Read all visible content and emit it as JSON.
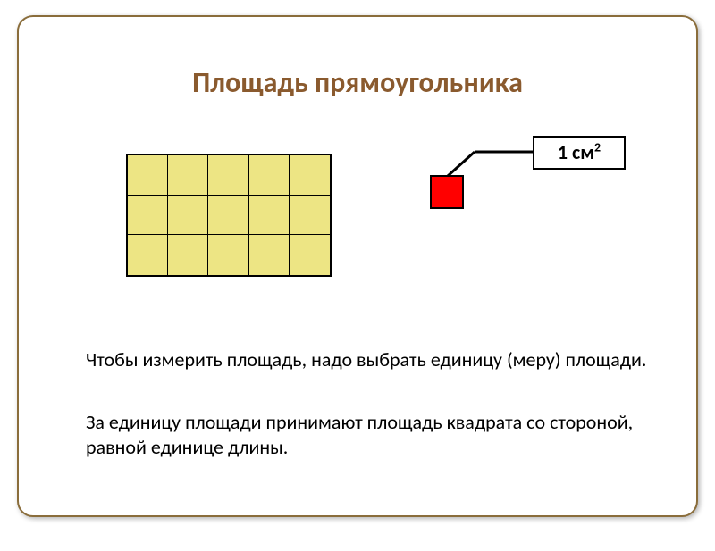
{
  "title": "Площадь прямоугольника",
  "unit_label_prefix": "1 см",
  "unit_label_exponent": "2",
  "paragraphs": {
    "p1": "Чтобы измерить площадь, надо выбрать единицу (меру) площади.",
    "p2": "За единицу площади принимают площадь квадрата со стороной, равной единице длины."
  },
  "grid": {
    "cols": 5,
    "rows": 3
  }
}
